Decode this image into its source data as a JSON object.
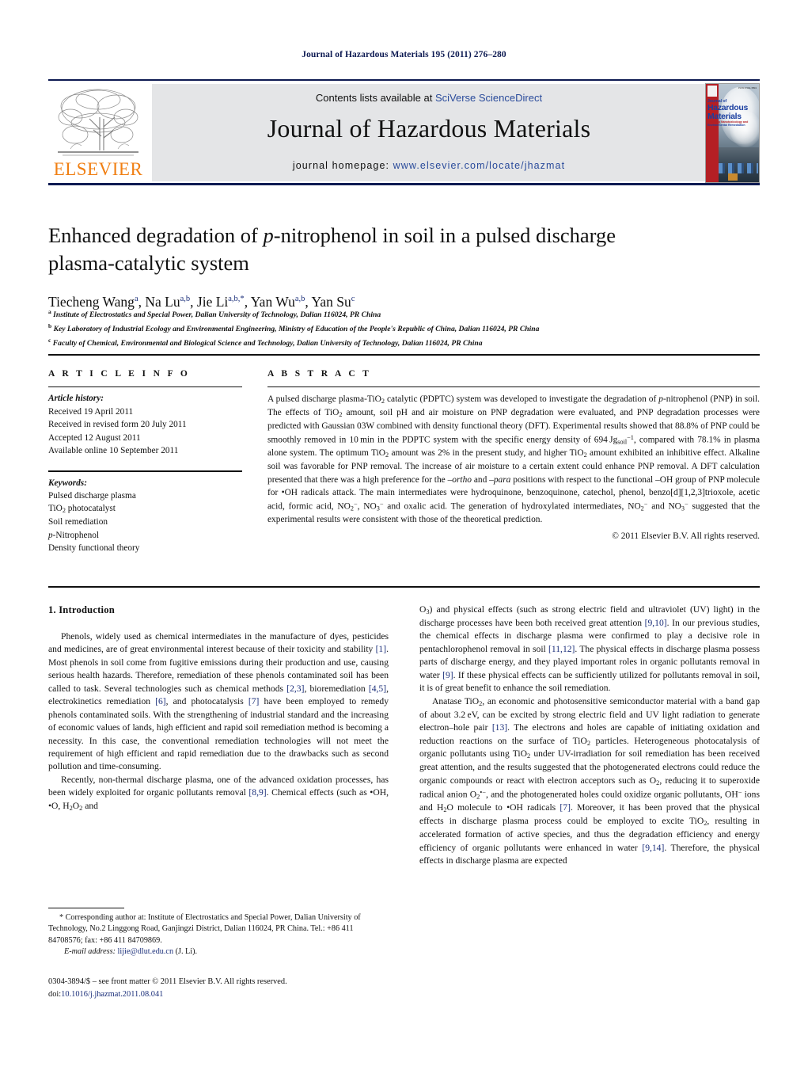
{
  "running_head": "Journal of Hazardous Materials 195 (2011) 276–280",
  "masthead": {
    "publisher_name": "ELSEVIER",
    "contents_prefix": "Contents lists available at ",
    "contents_link": "SciVerse ScienceDirect",
    "journal_title": "Journal of Hazardous Materials",
    "homepage_label": "journal homepage: ",
    "homepage_url": "www.elsevier.com/locate/jhazmat",
    "cover": {
      "line1": "Journal of",
      "line2": "Hazardous",
      "line3": "Materials",
      "line4": "Including Nanotoxicology and",
      "line5": "Environmental Remediation",
      "corner": "ISSN 0304-3894"
    }
  },
  "article": {
    "title_line1_a": "Enhanced degradation of ",
    "title_line1_italic": "p",
    "title_line1_b": "-nitrophenol in soil in a pulsed discharge",
    "title_line2": "plasma-catalytic system",
    "authors": [
      {
        "name": "Tiecheng Wang",
        "sup": "a",
        "sep": ", "
      },
      {
        "name": "Na Lu",
        "sup": "a,b",
        "sep": ", "
      },
      {
        "name": "Jie Li",
        "sup": "a,b,*",
        "sep": ", "
      },
      {
        "name": "Yan Wu",
        "sup": "a,b",
        "sep": ", "
      },
      {
        "name": "Yan Su",
        "sup": "c",
        "sep": ""
      }
    ],
    "affiliations": [
      {
        "marker": "a",
        "text": "Institute of Electrostatics and Special Power, Dalian University of Technology, Dalian 116024, PR China"
      },
      {
        "marker": "b",
        "text": "Key Laboratory of Industrial Ecology and Environmental Engineering, Ministry of Education of the People's Republic of China, Dalian 116024, PR China"
      },
      {
        "marker": "c",
        "text": "Faculty of Chemical, Environmental and Biological Science and Technology, Dalian University of Technology, Dalian 116024, PR China"
      }
    ]
  },
  "article_info": {
    "heading": "A R T I C L E   I N F O",
    "history_label": "Article history:",
    "history": [
      "Received 19 April 2011",
      "Received in revised form 20 July 2011",
      "Accepted 12 August 2011",
      "Available online 10 September 2011"
    ],
    "keywords_label": "Keywords:",
    "keywords": [
      "Pulsed discharge plasma",
      "TiO2 photocatalyst",
      "Soil remediation",
      "p-Nitrophenol",
      "Density functional theory"
    ]
  },
  "abstract": {
    "heading": "A B S T R A C T",
    "copyright": "© 2011 Elsevier B.V. All rights reserved."
  },
  "introduction": {
    "heading": "1.  Introduction"
  },
  "footnote": {
    "corresponding": "* Corresponding author at: Institute of Electrostatics and Special Power, Dalian University of Technology, No.2 Linggong Road, Ganjingzi District, Dalian 116024, PR China. Tel.: +86 411 84708576; fax: +86 411 84709869.",
    "email_label": "E-mail address:",
    "email": "lijie@dlut.edu.cn",
    "email_attrib": "(J. Li)."
  },
  "colophon": {
    "issn_line": "0304-3894/$ – see front matter © 2011 Elsevier B.V. All rights reserved.",
    "doi_label": "doi:",
    "doi": "10.1016/j.jhazmat.2011.08.041"
  },
  "colors": {
    "link": "#1b2f7a",
    "elsevier_orange": "#f07f13",
    "banner_gray": "#e4e5e7",
    "navy_rule": "#0d1a52"
  }
}
